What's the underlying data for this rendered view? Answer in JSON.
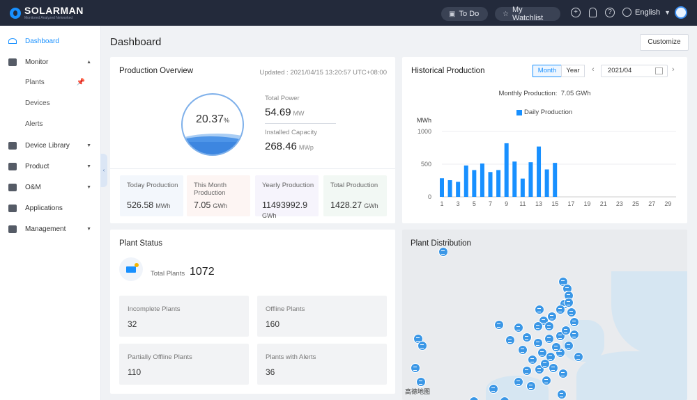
{
  "brand": {
    "name": "SOLARMAN",
    "tagline": "Monitored Analyzed Networked"
  },
  "topbar": {
    "todo": "To Do",
    "watchlist": "My Watchlist",
    "language": "English"
  },
  "sidebar": {
    "items": [
      {
        "label": "Dashboard"
      },
      {
        "label": "Monitor"
      },
      {
        "label": "Device Library"
      },
      {
        "label": "Product"
      },
      {
        "label": "O&M"
      },
      {
        "label": "Applications"
      },
      {
        "label": "Management"
      }
    ],
    "monitor_sub": [
      "Plants",
      "Devices",
      "Alerts"
    ]
  },
  "page": {
    "title": "Dashboard",
    "customize": "Customize"
  },
  "overview": {
    "title": "Production Overview",
    "updated": "Updated : 2021/04/15 13:20:57 UTC+08:00",
    "percent": "20.37",
    "percent_unit": "%",
    "percent_value": 20.37,
    "total_power_label": "Total Power",
    "total_power_value": "54.69",
    "total_power_unit": "MW",
    "installed_label": "Installed Capacity",
    "installed_value": "268.46",
    "installed_unit": "MWp",
    "stats": [
      {
        "label": "Today Production",
        "value": "526.58",
        "unit": "MWh"
      },
      {
        "label": "This Month Production",
        "value": "7.05",
        "unit": "GWh"
      },
      {
        "label": "Yearly Production",
        "value": "11493992.9",
        "unit": "GWh"
      },
      {
        "label": "Total Production",
        "value": "1428.27",
        "unit": "GWh"
      }
    ]
  },
  "historical": {
    "title": "Historical Production",
    "tabs": [
      "Month",
      "Year"
    ],
    "date": "2021/04",
    "monthly_label": "Monthly Production:",
    "monthly_value": "7.05 GWh",
    "legend": "Daily Production",
    "yunit": "MWh"
  },
  "chart_data": {
    "type": "bar",
    "series": [
      {
        "name": "Daily Production",
        "color": "#1890ff",
        "values": [
          285,
          255,
          230,
          480,
          410,
          510,
          380,
          410,
          820,
          540,
          280,
          530,
          770,
          420,
          520
        ]
      }
    ],
    "x": [
      1,
      2,
      3,
      4,
      5,
      6,
      7,
      8,
      9,
      10,
      11,
      12,
      13,
      14,
      15
    ],
    "xlim": [
      1,
      30
    ],
    "xticks": [
      "1",
      "3",
      "5",
      "7",
      "9",
      "11",
      "13",
      "15",
      "17",
      "19",
      "21",
      "23",
      "25",
      "27",
      "29"
    ],
    "yticks": [
      "0",
      "500",
      "1000"
    ],
    "ylim": [
      0,
      1000
    ],
    "ylabel": "MWh",
    "grid": true,
    "legend_position": "top"
  },
  "status": {
    "title": "Plant Status",
    "total_label": "Total Plants",
    "total_value": "1072",
    "boxes": [
      {
        "label": "Incomplete Plants",
        "value": "32"
      },
      {
        "label": "Offline Plants",
        "value": "160"
      },
      {
        "label": "Partially Offline Plants",
        "value": "110"
      },
      {
        "label": "Plants with Alerts",
        "value": "36"
      }
    ]
  },
  "map": {
    "title": "Plant Distribution",
    "credit": "高德地图"
  }
}
